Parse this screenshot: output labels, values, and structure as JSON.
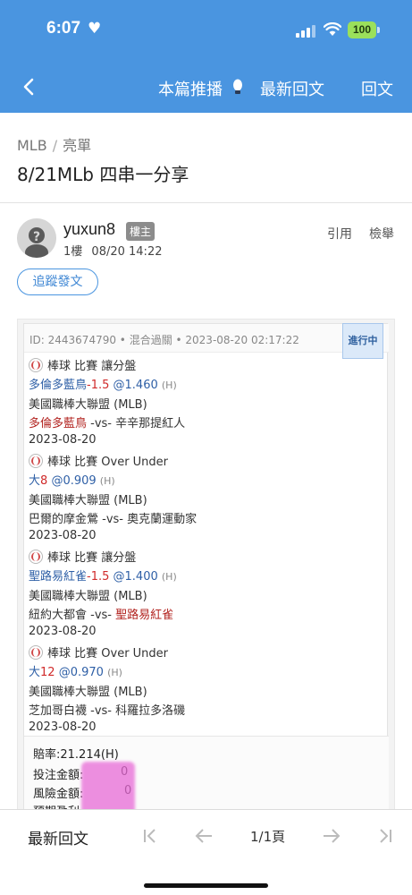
{
  "status_bar": {
    "time": "6:07",
    "battery": "100"
  },
  "nav": {
    "push_label": "本篇推播",
    "latest_label": "最新回文",
    "reply_label": "回文"
  },
  "breadcrumb": {
    "board": "MLB",
    "category": "亮單"
  },
  "post": {
    "title": "8/21MLb 四串一分享",
    "author": "yuxun8",
    "op_badge": "樓主",
    "floor": "1樓",
    "datetime": "08/20 14:22",
    "quote_label": "引用",
    "report_label": "檢舉",
    "follow_label": "追蹤發文"
  },
  "bet": {
    "id_line": "ID: 2443674790 • 混合過關 • 2023-08-20 02:17:22",
    "status": "進行中",
    "legs": [
      {
        "type": "棒球 比賽 讓分盤",
        "pick": "多倫多藍鳥",
        "line": "-1.5",
        "odds": "@1.460",
        "side": "(H)",
        "league": "美國職棒大聯盟 (MLB)",
        "home": "多倫多藍鳥",
        "vs": " -vs- ",
        "away": "辛辛那提紅人",
        "date": "2023-08-20"
      },
      {
        "type": "棒球 比賽 Over Under",
        "pick": "大",
        "line": "8",
        "odds": "@0.909",
        "side": "(H)",
        "league": "美國職棒大聯盟 (MLB)",
        "home": "巴爾的摩金鶯",
        "vs": " -vs- ",
        "away": "奧克蘭運動家",
        "date": "2023-08-20"
      },
      {
        "type": "棒球 比賽 讓分盤",
        "pick": "聖路易紅雀",
        "line": "-1.5",
        "odds": "@1.400",
        "side": "(H)",
        "league": "美國職棒大聯盟 (MLB)",
        "home": "紐約大都會",
        "vs": " -vs- ",
        "away": "聖路易紅雀",
        "date": "2023-08-20"
      },
      {
        "type": "棒球 比賽 Over Under",
        "pick": "大",
        "line": "12",
        "odds": "@0.970",
        "side": "(H)",
        "league": "美國職棒大聯盟 (MLB)",
        "home": "芝加哥白襪",
        "vs": " -vs- ",
        "away": "科羅拉多洛磯",
        "date": "2023-08-20"
      }
    ],
    "total_odds": "賠率:21.214(H)",
    "stake_label": "投注金額:",
    "risk_label": "風險金額:",
    "profit_label": "預期盈利:",
    "stake_tail": "0",
    "risk_tail": "0"
  },
  "bottom_bar": {
    "latest_label": "最新回文",
    "page": "1/1頁"
  },
  "colors": {
    "header": "#4a95e0",
    "link_blue": "#2e5fa6",
    "red": "#d02a2a",
    "purple": "#7b2c9e"
  }
}
